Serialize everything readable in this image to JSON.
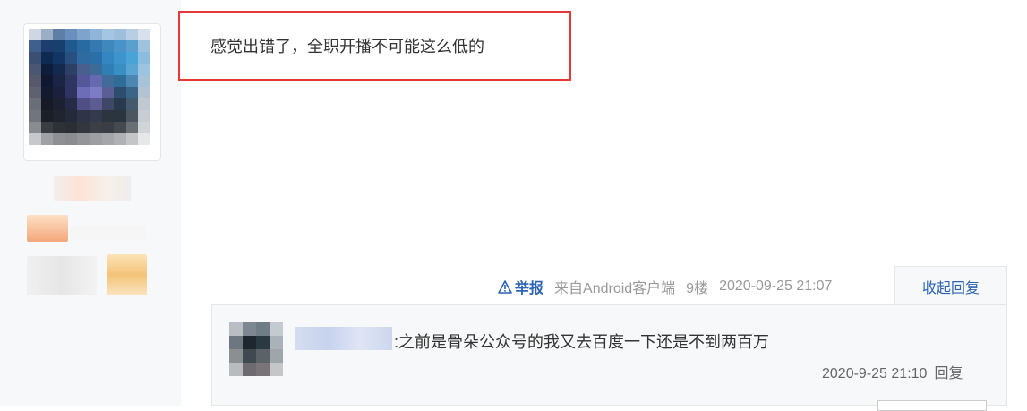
{
  "post": {
    "content": "感觉出错了，全职开播不可能这么低的"
  },
  "meta": {
    "report_label": "举报",
    "source": "来自Android客户端",
    "floor": "9楼",
    "timestamp": "2020-09-25 21:07",
    "collapse_label": "收起回复"
  },
  "reply": {
    "text": ":之前是骨朵公众号的我又去百度一下还是不到两百万",
    "timestamp": "2020-9-25 21:10",
    "reply_label": "回复"
  },
  "colors": {
    "link": "#2d64b3",
    "highlight": "#e53935"
  },
  "icons": {
    "report": "warning-triangle-icon"
  }
}
